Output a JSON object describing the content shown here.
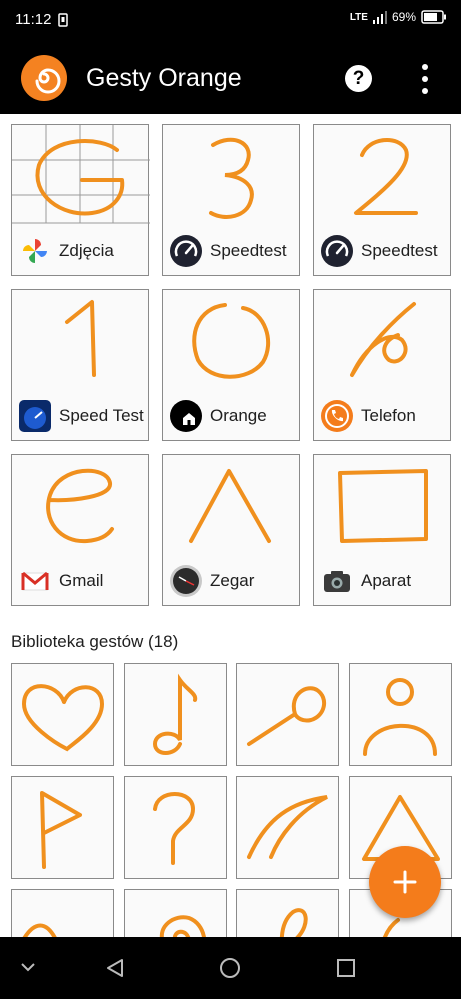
{
  "status": {
    "time": "11:12",
    "network": "LTE",
    "battery": "69%"
  },
  "app_bar": {
    "title": "Gesty Orange",
    "help_icon": "question-circle-icon",
    "menu_icon": "more-vert-icon"
  },
  "gestures": [
    {
      "glyph": "G",
      "app": "Zdjęcia",
      "icon": "google-photos-icon"
    },
    {
      "glyph": "3",
      "app": "Speedtest",
      "icon": "speedtest-icon"
    },
    {
      "glyph": "2",
      "app": "Speedtest",
      "icon": "speedtest-icon"
    },
    {
      "glyph": "1",
      "app": "Speed Test",
      "icon": "speed-test-icon"
    },
    {
      "glyph": "O",
      "app": "Orange",
      "icon": "orange-home-icon"
    },
    {
      "glyph": "6",
      "app": "Telefon",
      "icon": "phone-icon"
    },
    {
      "glyph": "e",
      "app": "Gmail",
      "icon": "gmail-icon"
    },
    {
      "glyph": "Λ",
      "app": "Zegar",
      "icon": "clock-icon"
    },
    {
      "glyph": "□",
      "app": "Aparat",
      "icon": "camera-icon"
    }
  ],
  "library": {
    "title": "Biblioteka gestów (18)",
    "items": [
      "heart",
      "music-note",
      "lollipop",
      "person",
      "flag",
      "question-mark",
      "arc",
      "triangle",
      "wave",
      "spiral",
      "loop",
      "partial"
    ]
  },
  "fab": {
    "label": "+",
    "icon": "add-icon"
  },
  "nav": {
    "items": [
      "collapse-icon",
      "back-icon",
      "home-icon",
      "recents-icon"
    ]
  },
  "colors": {
    "accent": "#f48221",
    "stroke": "#f0901e"
  }
}
